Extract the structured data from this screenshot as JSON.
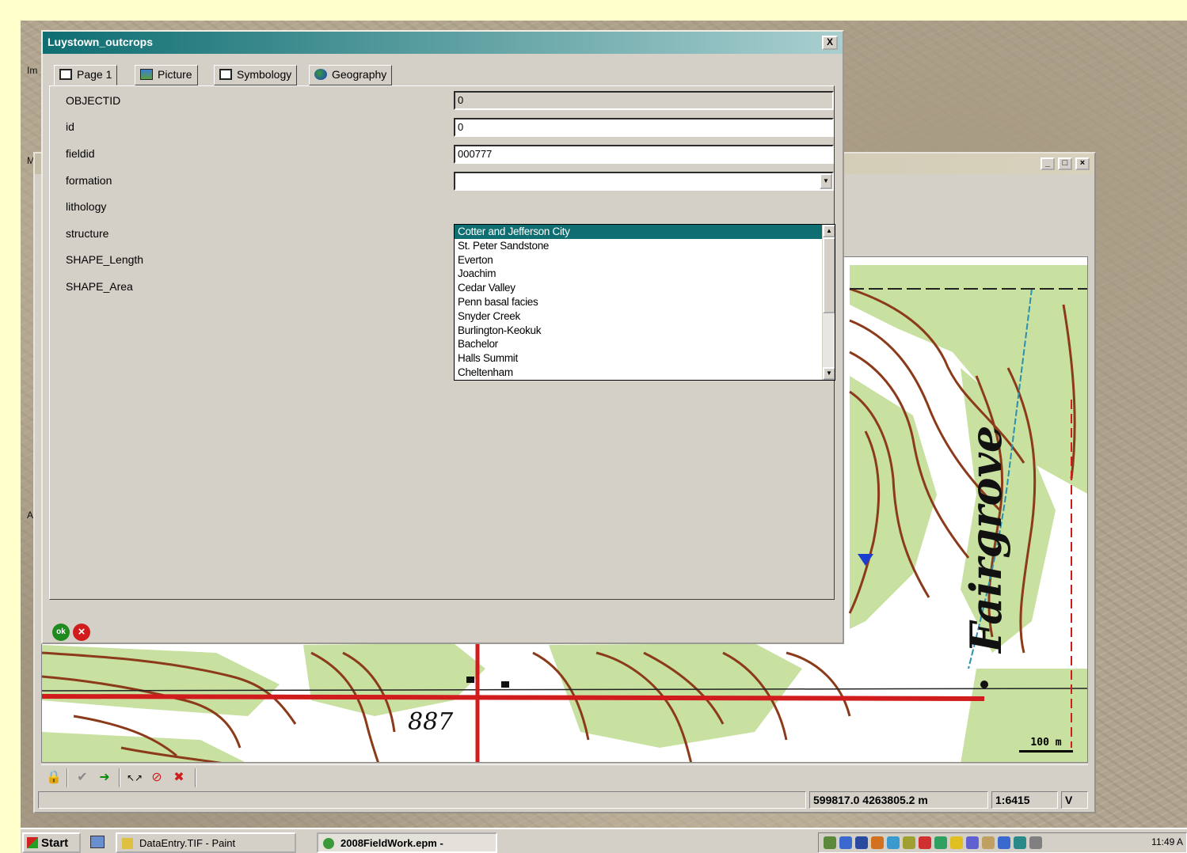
{
  "desktop": {
    "side_labels": [
      "Im",
      "M",
      "A"
    ]
  },
  "map_window": {
    "scale_bar_label": "100 m",
    "map_label_elevation": "887",
    "map_label_place": "Fairgrove",
    "status": {
      "coordinates": "599817.0 4263805.2 m",
      "scale": "1:6415",
      "mode": "V"
    },
    "toolbar_icons": [
      "lock-icon",
      "check-disabled-icon",
      "green-arrow-icon",
      "sketch-icon",
      "no-edit-icon",
      "red-cancel-icon"
    ]
  },
  "attribute_dialog": {
    "title": "Luystown_outcrops",
    "close_label": "X",
    "tabs": [
      {
        "label": "Page 1",
        "icon": "form-icon"
      },
      {
        "label": "Picture",
        "icon": "picture-icon"
      },
      {
        "label": "Symbology",
        "icon": "symbology-icon"
      },
      {
        "label": "Geography",
        "icon": "globe-icon"
      }
    ],
    "fields": [
      {
        "label": "OBJECTID",
        "value": "0"
      },
      {
        "label": "id",
        "value": "0"
      },
      {
        "label": "fieldid",
        "value": "000777"
      },
      {
        "label": "formation",
        "value": ""
      },
      {
        "label": "lithology",
        "value": ""
      },
      {
        "label": "structure",
        "value": ""
      },
      {
        "label": "SHAPE_Length",
        "value": ""
      },
      {
        "label": "SHAPE_Area",
        "value": ""
      }
    ],
    "formation_options": [
      "Cotter and Jefferson City",
      "St. Peter Sandstone",
      "Everton",
      "Joachim",
      "Cedar Valley",
      "Penn basal facies",
      "Snyder Creek",
      "Burlington-Keokuk",
      "Bachelor",
      "Halls Summit",
      "Cheltenham"
    ],
    "selected_option": "Cotter and Jefferson City",
    "ok_label": "ok",
    "cancel_label": "×"
  },
  "taskbar": {
    "start_label": "Start",
    "tasks": [
      {
        "label": "DataEntry.TIF - Paint"
      },
      {
        "label": "2008FieldWork.epm -"
      }
    ],
    "clock": "11:49 A"
  },
  "colors": {
    "dialog_title": "#0e6e72",
    "selection": "#0e6e72",
    "contour": "#8b3a1a",
    "vegetation": "#c8e0a0",
    "road": "#d01c1c"
  }
}
